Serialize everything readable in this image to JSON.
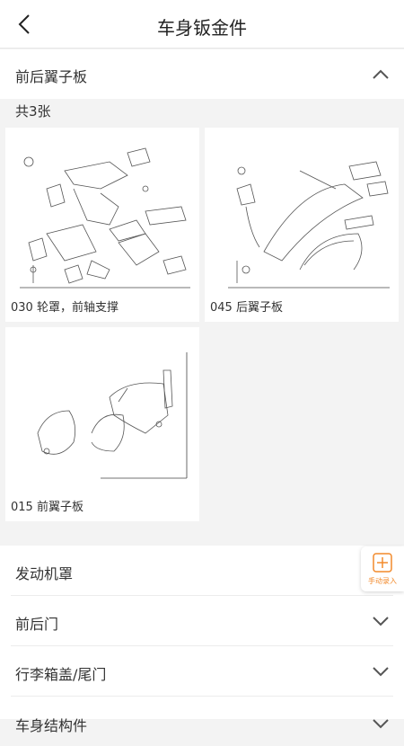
{
  "header": {
    "title": "车身钣金件"
  },
  "expanded_section": {
    "title": "前后翼子板",
    "count_text": "共3张",
    "cards": [
      {
        "caption": "030 轮罩，前轴支撑"
      },
      {
        "caption": "045 后翼子板"
      },
      {
        "caption": "015 前翼子板"
      }
    ]
  },
  "collapsed_sections": [
    {
      "title": "发动机罩"
    },
    {
      "title": "前后门"
    },
    {
      "title": "行李箱盖/尾门"
    },
    {
      "title": "车身结构件"
    }
  ],
  "fab": {
    "label": "手动录入",
    "accent": "#f28a2c"
  },
  "icons": [
    "back-icon",
    "chevron-up-icon",
    "chevron-down-icon",
    "plus-icon"
  ]
}
